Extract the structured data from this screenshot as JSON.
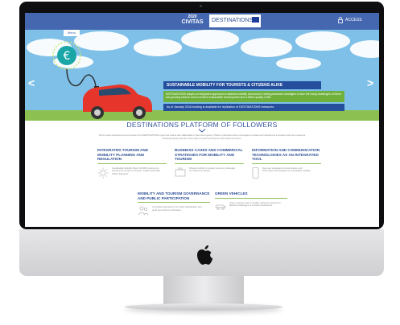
{
  "header": {
    "logo_line1": "2020",
    "logo_line2": "CIVITAS",
    "site_name": "DESTINATIONS",
    "access_label": "ACCESS",
    "menu_label": "Menu"
  },
  "hero": {
    "slogan": "SUSTAINABLE MOBILITY FOR TOURISTS & CITIZENS ALIKE",
    "description": "DESTINATIONS adopts an integrated approach to address mobility and tourism, testing balanced strategies to face the rising challenges of these two growing sectors and to achieve sustainable development and a better quality of life.",
    "funding": "As of January 2016 funding is available for replication of DESTINATIONS measures."
  },
  "platform": {
    "title": "DESTINATIONS PLATFORM OF FOLLOWERS",
    "intro": "All the major achievements and results of the DESTINATIONS project are shared with stakeholders (cities and regions). Platform participants are encouraged to uptake and replicate the innovative tools and measures developed during the life of the project to serve and improve their areas of tourism."
  },
  "cards": [
    {
      "title": "INTEGRATED TOURISM AND MOBILITY PLANNING AND REGULATION",
      "text": "Sustainable Mobility Plans (SUMPs) taking into account the impact of Tourism, freight and public Public Transport"
    },
    {
      "title": "BUSINESS CASES AND COMMERCIAL STRATEGIES FOR MOBILITY AND TOURISM",
      "text": "Shared mobility & smarter economy strategies for citizens & tourists"
    },
    {
      "title": "INFORMATION AND COMMUNICATION TECHNOLOGIES AS AN INTEGRATED TOOL",
      "text": "New and integrated communication and information technologies for sustainable mobility"
    },
    {
      "title": "MOBILITY AND TOURISM GOVERNANCE AND PUBLIC PARTICIPATION",
      "text": "Innovative approaches for public participation and good governance techniques"
    },
    {
      "title": "GREEN VEHICLES",
      "text": "Green vehicles and e-mobility: effective practices to address challenges of touristic destinations"
    }
  ]
}
